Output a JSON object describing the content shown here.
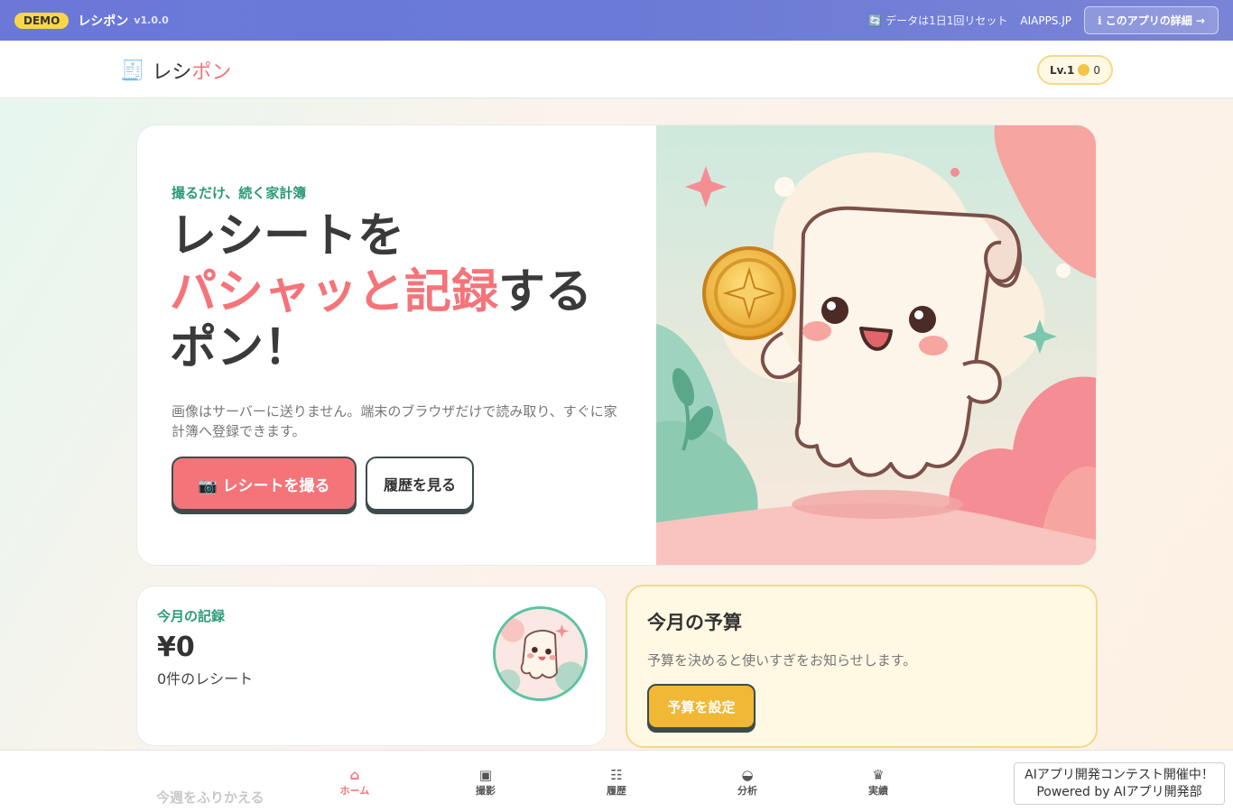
{
  "demo_bar": {
    "badge": "DEMO",
    "app_name": "レシポン",
    "version": "v1.0.0",
    "reset_note": "🔄 データは1日1回リセット",
    "site_link": "AIAPPS.JP",
    "detail_button": "ℹ このアプリの詳細 →"
  },
  "header": {
    "logo_icon": "🧾",
    "logo_part1": "レシ",
    "logo_part2": "ポン",
    "level": "Lv.1",
    "coins": "0"
  },
  "hero": {
    "eyebrow": "撮るだけ、続く家計簿",
    "title_line1": "レシートを",
    "title_highlight": "パシャッと記録",
    "title_line2_rest": "する",
    "title_line3": "ポン！",
    "description": "画像はサーバーに送りません。端末のブラウザだけで読み取り、すぐに家計簿へ登録できます。",
    "primary_button": "📷 レシートを撮る",
    "secondary_button": "履歴を見る"
  },
  "stats": {
    "label": "今月の記録",
    "amount": "¥0",
    "count": "0件のレシート"
  },
  "budget": {
    "title": "今月の予算",
    "description": "予算を決めると使いすぎをお知らせします。",
    "button": "予算を設定"
  },
  "below_fold": {
    "section_title": "今週をふりかえる"
  },
  "bottom_nav": {
    "items": [
      {
        "icon": "⌂",
        "label": "ホーム"
      },
      {
        "icon": "▣",
        "label": "撮影"
      },
      {
        "icon": "☷",
        "label": "履歴"
      },
      {
        "icon": "◒",
        "label": "分析"
      },
      {
        "icon": "♛",
        "label": "実績"
      }
    ],
    "active_index": 0
  },
  "contest": {
    "line1": "AIアプリ開発コンテスト開催中！",
    "line2": "Powered by AIアプリ開発部"
  },
  "colors": {
    "accent_pink": "#f4747a",
    "accent_green": "#2e9a78",
    "accent_yellow": "#f0b835",
    "demo_bar": "#6b78d8"
  }
}
